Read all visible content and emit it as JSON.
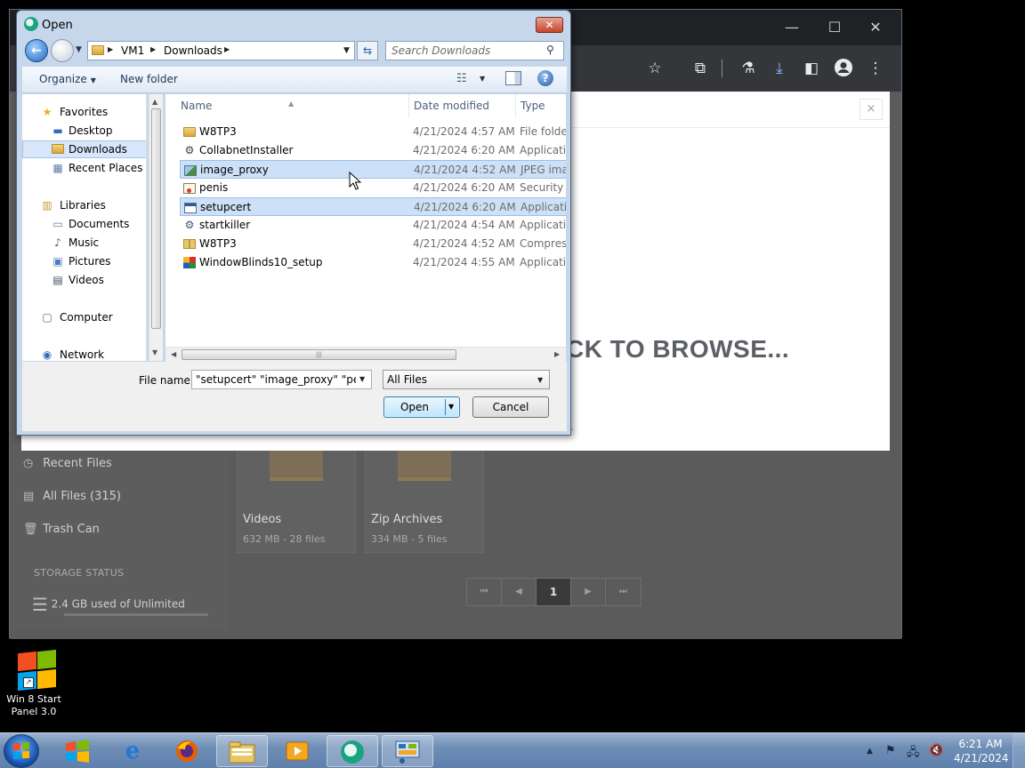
{
  "browser": {
    "controls": [
      "—",
      "☐",
      "✕"
    ],
    "toolbar_icons": [
      "star-icon",
      "puzzle-icon",
      "flask-icon",
      "download-icon",
      "sidepanel-icon",
      "profile-icon",
      "menu-icon"
    ]
  },
  "page": {
    "modal_close": "×",
    "browse_text": "CK TO BROWSE...",
    "dot": ".",
    "nav": [
      {
        "label": "Recent Files",
        "icon": "clock-icon"
      },
      {
        "label": "All Files (315)",
        "icon": "files-icon"
      },
      {
        "label": "Trash Can",
        "icon": "trash-icon"
      }
    ],
    "storage_title": "STORAGE STATUS",
    "storage_text": "2.4 GB used of Unlimited",
    "folders": [
      {
        "name": "Videos",
        "meta": "632 MB - 28 files"
      },
      {
        "name": "Zip Archives",
        "meta": "334 MB - 5 files"
      }
    ],
    "pager": {
      "first": "⏮",
      "prev": "◀",
      "current": "1",
      "next": "▶",
      "last": "⏭"
    }
  },
  "dialog": {
    "title": "Open",
    "close": "✕",
    "path": [
      "VM1",
      "Downloads"
    ],
    "search_placeholder": "Search Downloads",
    "organize": "Organize",
    "new_folder": "New folder",
    "nav": {
      "favorites": "Favorites",
      "desktop": "Desktop",
      "downloads": "Downloads",
      "recent": "Recent Places",
      "libraries": "Libraries",
      "documents": "Documents",
      "music": "Music",
      "pictures": "Pictures",
      "videos": "Videos",
      "computer": "Computer",
      "network": "Network"
    },
    "columns": {
      "name": "Name",
      "date": "Date modified",
      "type": "Type"
    },
    "files": [
      {
        "name": "W8TP3",
        "date": "4/21/2024 4:57 AM",
        "type": "File folder",
        "icon": "folder-icon",
        "selected": false
      },
      {
        "name": "CollabnetInstaller",
        "date": "4/21/2024 6:20 AM",
        "type": "Applicatio",
        "icon": "installer-icon",
        "selected": false
      },
      {
        "name": "image_proxy",
        "date": "4/21/2024 4:52 AM",
        "type": "JPEG imag",
        "icon": "image-icon",
        "selected": true
      },
      {
        "name": "penis",
        "date": "4/21/2024 6:20 AM",
        "type": "Security C",
        "icon": "certificate-icon",
        "selected": false
      },
      {
        "name": "setupcert",
        "date": "4/21/2024 6:20 AM",
        "type": "Applicatio",
        "icon": "app-icon",
        "selected": true
      },
      {
        "name": "startkiller",
        "date": "4/21/2024 4:54 AM",
        "type": "Applicatio",
        "icon": "installer-icon",
        "selected": false
      },
      {
        "name": "W8TP3",
        "date": "4/21/2024 4:52 AM",
        "type": "Compress",
        "icon": "zip-icon",
        "selected": false
      },
      {
        "name": "WindowBlinds10_setup",
        "date": "4/21/2024 4:55 AM",
        "type": "Applicatio",
        "icon": "windowblinds-icon",
        "selected": false
      }
    ],
    "file_name_label": "File name:",
    "file_name_value": "\"setupcert\" \"image_proxy\" \"penis\"",
    "file_type": "All Files",
    "open_label": "Open",
    "cancel_label": "Cancel"
  },
  "desktop": {
    "icon_label": "Win 8 Start Panel 3.0"
  },
  "taskbar": {
    "apps": [
      "windows-logo-icon",
      "ie-icon",
      "firefox-icon",
      "explorer-icon",
      "media-icon",
      "app-active-icon",
      "control-panel-icon"
    ],
    "time": "6:21 AM",
    "date": "4/21/2024"
  }
}
